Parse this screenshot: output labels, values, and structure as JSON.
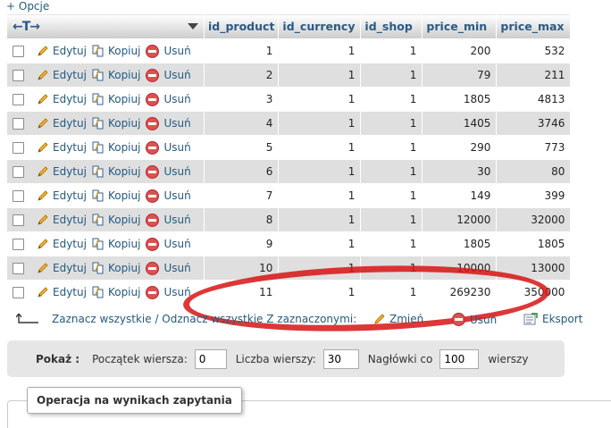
{
  "options_link": "+ Opcje",
  "header": {
    "arrows": "←T→",
    "columns": [
      "id_product",
      "id_currency",
      "id_shop",
      "price_min",
      "price_max"
    ]
  },
  "actions": {
    "edit": "Edytuj",
    "copy": "Kopiuj",
    "delete": "Usuń"
  },
  "rows": [
    [
      "1",
      "1",
      "1",
      "200",
      "532"
    ],
    [
      "2",
      "1",
      "1",
      "79",
      "211"
    ],
    [
      "3",
      "1",
      "1",
      "1805",
      "4813"
    ],
    [
      "4",
      "1",
      "1",
      "1405",
      "3746"
    ],
    [
      "5",
      "1",
      "1",
      "290",
      "773"
    ],
    [
      "6",
      "1",
      "1",
      "30",
      "80"
    ],
    [
      "7",
      "1",
      "1",
      "149",
      "399"
    ],
    [
      "8",
      "1",
      "1",
      "12000",
      "32000"
    ],
    [
      "9",
      "1",
      "1",
      "1805",
      "1805"
    ],
    [
      "10",
      "1",
      "1",
      "10000",
      "13000"
    ],
    [
      "11",
      "1",
      "1",
      "269230",
      "350000"
    ]
  ],
  "bulk": {
    "check_all": "Zaznacz wszystkie / Odznacz wszystkie Z zaznaczonymi:",
    "change": "Zmień",
    "delete": "Usuń",
    "export": "Eksport"
  },
  "nav": {
    "show": "Pokaż :",
    "start_label": "Początek wiersza:",
    "start_value": "0",
    "rows_label": "Liczba wierszy:",
    "rows_value": "30",
    "headers_label": "Nagłówki co",
    "headers_value": "100",
    "headers_suffix": "wierszy"
  },
  "fieldset_legend": "Operacja na wynikach zapytania",
  "colors": {
    "link": "#235a81",
    "row_alt": "#dfdfdf",
    "annotation": "#d71414"
  }
}
